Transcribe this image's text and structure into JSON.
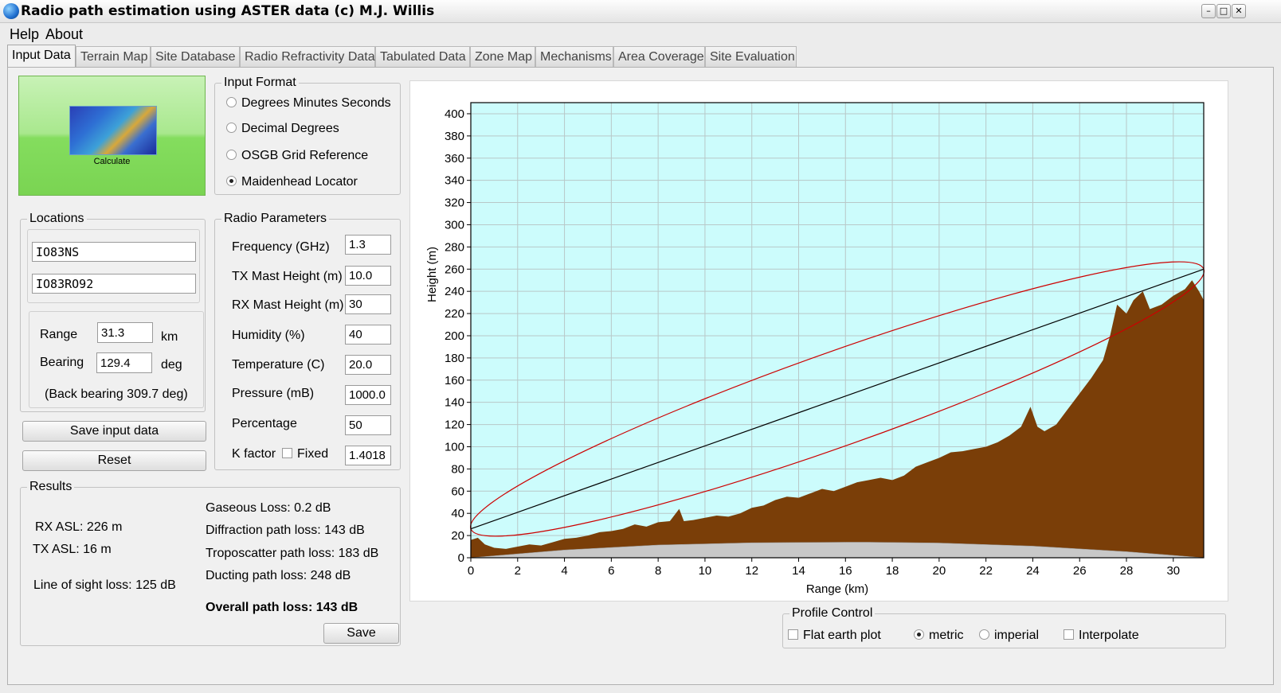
{
  "window": {
    "title": "Radio path estimation using ASTER data (c) M.J. Willis",
    "controls": [
      "–",
      "□",
      "✕"
    ]
  },
  "menu": [
    "Help",
    "About"
  ],
  "tabs": [
    "Input Data",
    "Terrain Map",
    "Site Database",
    "Radio Refractivity Data",
    "Tabulated Data",
    "Zone Map",
    "Mechanisms",
    "Area Coverage",
    "Site Evaluation"
  ],
  "calculate": {
    "label": "Calculate"
  },
  "input_format": {
    "legend": "Input Format",
    "options": [
      "Degrees Minutes Seconds",
      "Decimal Degrees",
      "OSGB Grid Reference",
      "Maidenhead Locator"
    ],
    "selected": "Maidenhead Locator"
  },
  "locations": {
    "legend": "Locations",
    "tx": "IO83NS",
    "rx": "IO83RO92",
    "range_label": "Range",
    "range_value": "31.3",
    "range_unit": "km",
    "bearing_label": "Bearing",
    "bearing_value": "129.4",
    "bearing_unit": "deg",
    "back_bearing": "(Back bearing 309.7 deg)"
  },
  "radio_parameters": {
    "legend": "Radio Parameters",
    "frequency_label": "Frequency (GHz)",
    "frequency": "1.3",
    "tx_mast_label": "TX Mast Height (m)",
    "tx_mast": "10.0",
    "rx_mast_label": "RX Mast Height (m)",
    "rx_mast": "30",
    "humidity_label": "Humidity (%)",
    "humidity": "40",
    "temperature_label": "Temperature (C)",
    "temperature": "20.0",
    "pressure_label": "Pressure (mB)",
    "pressure": "1000.0",
    "percentage_label": "Percentage",
    "percentage": "50",
    "k_factor_label": "K factor",
    "fixed_label": "Fixed",
    "k_factor": "1.4018"
  },
  "buttons": {
    "save_input": "Save input data",
    "reset": "Reset",
    "save": "Save"
  },
  "results": {
    "legend": "Results",
    "rx_asl": "RX ASL: 226 m",
    "tx_asl": "TX ASL: 16 m",
    "los_loss": "Line of sight loss: 125 dB",
    "gaseous": "Gaseous Loss: 0.2 dB",
    "diffraction": "Diffraction path loss: 143 dB",
    "troposcatter": "Troposcatter path loss: 183 dB",
    "ducting": "Ducting path loss: 248 dB",
    "overall": "Overall path loss: 143 dB"
  },
  "profile_control": {
    "legend": "Profile Control",
    "flat_earth": "Flat earth plot",
    "metric": "metric",
    "imperial": "imperial",
    "interpolate": "Interpolate",
    "unit_selected": "metric"
  },
  "chart_data": {
    "type": "area",
    "xlabel": "Range (km)",
    "ylabel": "Height (m)",
    "xlim": [
      0,
      31.3
    ],
    "ylim": [
      0,
      410
    ],
    "xticks": [
      0,
      2,
      4,
      6,
      8,
      10,
      12,
      14,
      16,
      18,
      20,
      22,
      24,
      26,
      28,
      30
    ],
    "yticks": [
      0,
      20,
      40,
      60,
      80,
      100,
      120,
      140,
      160,
      180,
      200,
      220,
      240,
      260,
      280,
      300,
      320,
      340,
      360,
      380,
      400
    ],
    "grid": true,
    "colors": {
      "plot_bg": "#ccfcfc",
      "terrain": "#7a3e08",
      "earth_bulge": "#c8c8c8",
      "fresnel": "#cc0000",
      "los": "#000000",
      "grid": "#b8c8c8"
    },
    "line_of_sight": {
      "x": [
        0,
        31.3
      ],
      "y": [
        26,
        260
      ]
    },
    "fresnel_ellipse": {
      "center_x": 15.65,
      "center_y": 143,
      "half_width_y": 18
    },
    "earth_bulge": {
      "x": [
        0,
        4,
        8,
        12,
        16,
        17,
        20,
        24,
        28,
        31.3
      ],
      "y": [
        0,
        7,
        11.5,
        13.5,
        14,
        14,
        13.3,
        10.5,
        5.5,
        0
      ]
    },
    "terrain": {
      "x": [
        0,
        0.3,
        0.6,
        1,
        1.5,
        2,
        2.5,
        3,
        3.5,
        4,
        4.5,
        5,
        5.5,
        6,
        6.5,
        7,
        7.5,
        8,
        8.5,
        8.9,
        9.1,
        9.5,
        10,
        10.5,
        11,
        11.5,
        12,
        12.5,
        13,
        13.5,
        14,
        14.5,
        15,
        15.5,
        16,
        16.5,
        17,
        17.5,
        18,
        18.5,
        19,
        19.5,
        20,
        20.5,
        21,
        21.5,
        22,
        22.5,
        23,
        23.5,
        23.9,
        24.2,
        24.5,
        25,
        25.5,
        26,
        26.5,
        27,
        27.3,
        27.6,
        28,
        28.3,
        28.7,
        29,
        29.5,
        30,
        30.5,
        30.8,
        31.1,
        31.3
      ],
      "y": [
        16,
        18,
        12,
        9,
        8,
        10,
        12,
        11,
        14,
        17,
        18,
        20,
        23,
        24,
        26,
        30,
        28,
        32,
        33,
        44,
        33,
        34,
        36,
        38,
        37,
        40,
        45,
        47,
        52,
        55,
        54,
        58,
        62,
        60,
        64,
        68,
        70,
        72,
        70,
        74,
        82,
        86,
        90,
        95,
        96,
        98,
        100,
        104,
        110,
        118,
        136,
        118,
        114,
        120,
        134,
        148,
        162,
        178,
        200,
        228,
        220,
        232,
        240,
        224,
        228,
        236,
        242,
        250,
        240,
        232
      ]
    }
  }
}
